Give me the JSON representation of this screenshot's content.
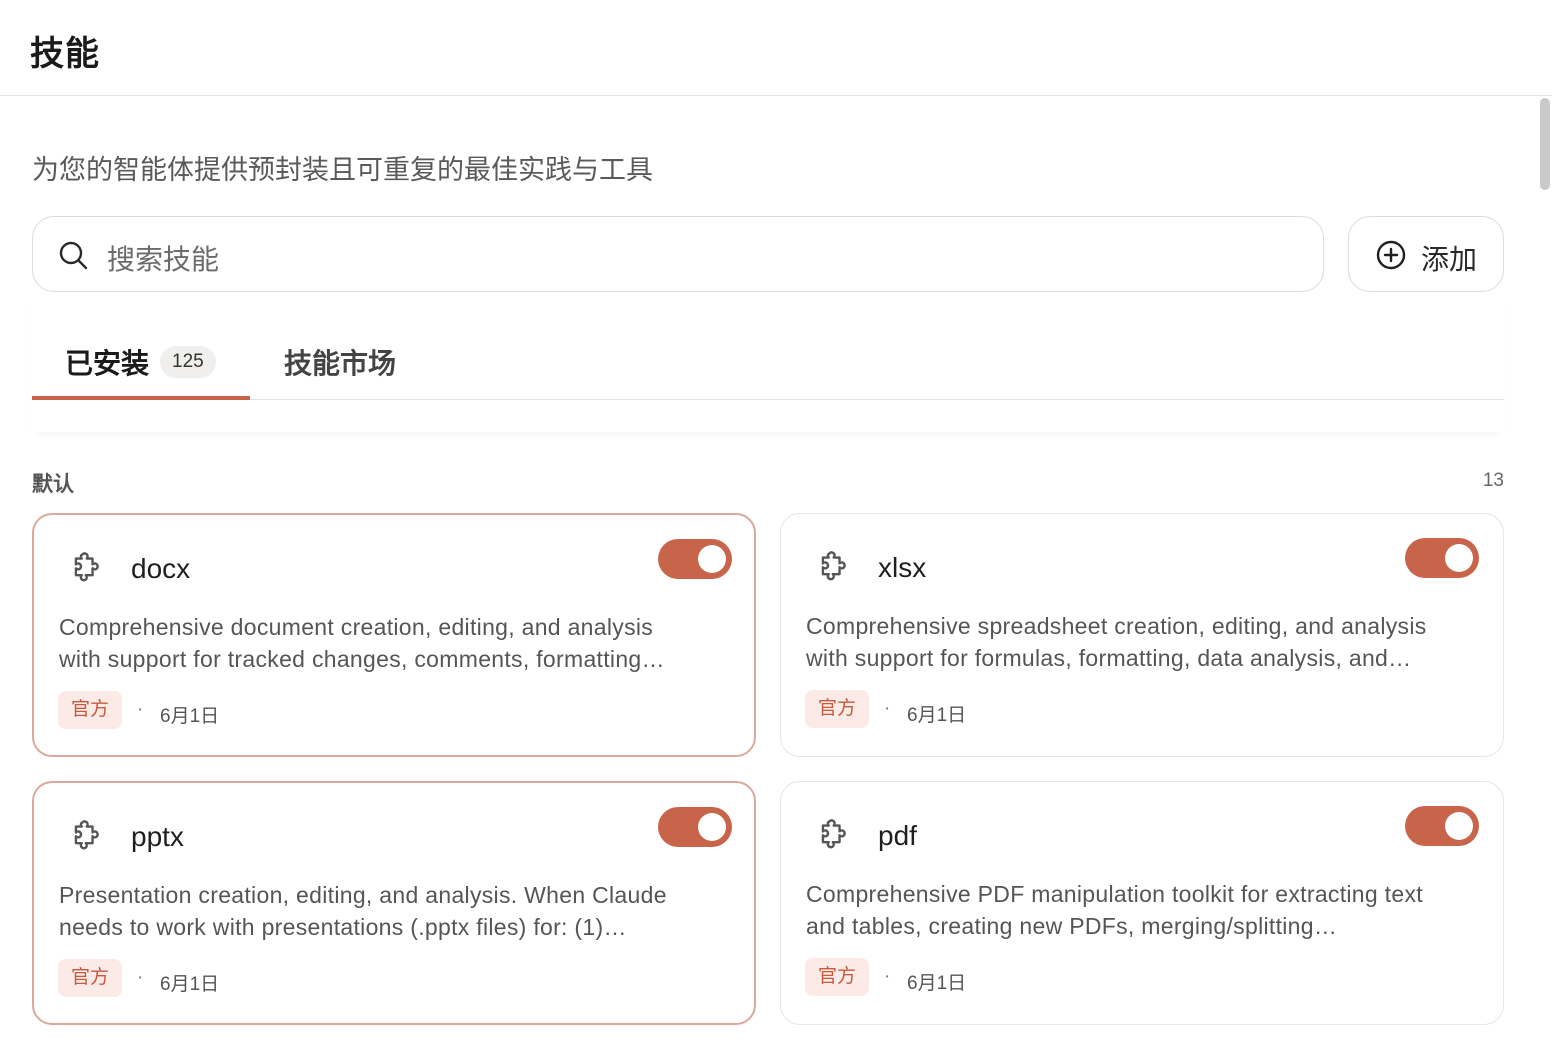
{
  "header": {
    "title": "技能"
  },
  "subtitle": "为您的智能体提供预封装且可重复的最佳实践与工具",
  "search": {
    "placeholder": "搜索技能",
    "icon": "search-icon"
  },
  "add_button": {
    "label": "添加",
    "icon": "plus-circle-icon"
  },
  "tabs": [
    {
      "label": "已安装",
      "count": "125",
      "active": true
    },
    {
      "label": "技能市场",
      "active": false
    }
  ],
  "section": {
    "name": "默认",
    "count": "13"
  },
  "accent_color": "#c8644a",
  "skills": [
    {
      "name": "docx",
      "desc_line1": "Comprehensive document creation, editing, and analysis",
      "desc_line2": "with support for tracked changes, comments, formatting…",
      "badge": "官方",
      "separator": "·",
      "date": "6月1日",
      "enabled": true,
      "icon": "puzzle-icon"
    },
    {
      "name": "xlsx",
      "desc_line1": "Comprehensive spreadsheet creation, editing, and analysis",
      "desc_line2": "with support for formulas, formatting, data analysis, and…",
      "badge": "官方",
      "separator": "·",
      "date": "6月1日",
      "enabled": true,
      "icon": "puzzle-icon"
    },
    {
      "name": "pptx",
      "desc_line1": "Presentation creation, editing, and analysis. When Claude",
      "desc_line2": "needs to work with presentations (.pptx files) for: (1)…",
      "badge": "官方",
      "separator": "·",
      "date": "6月1日",
      "enabled": true,
      "icon": "puzzle-icon"
    },
    {
      "name": "pdf",
      "desc_line1": "Comprehensive PDF manipulation toolkit for extracting text",
      "desc_line2": "and tables, creating new PDFs, merging/splitting…",
      "badge": "官方",
      "separator": "·",
      "date": "6月1日",
      "enabled": true,
      "icon": "puzzle-icon"
    }
  ]
}
